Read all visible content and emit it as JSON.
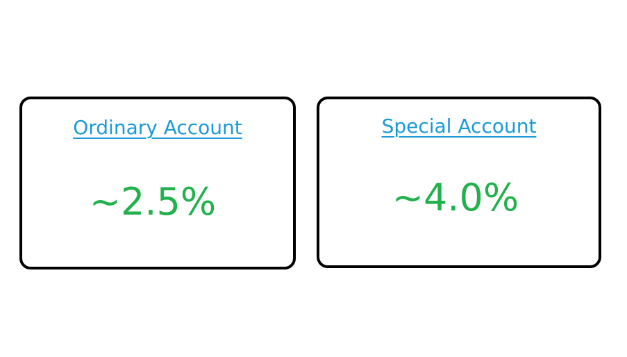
{
  "colors": {
    "link": "#1a9ad6",
    "rate": "#22b14c",
    "border": "#000000"
  },
  "accounts": [
    {
      "title": "Ordinary Account",
      "rate": "~2.5%"
    },
    {
      "title": "Special Account",
      "rate": "~4.0%"
    }
  ]
}
